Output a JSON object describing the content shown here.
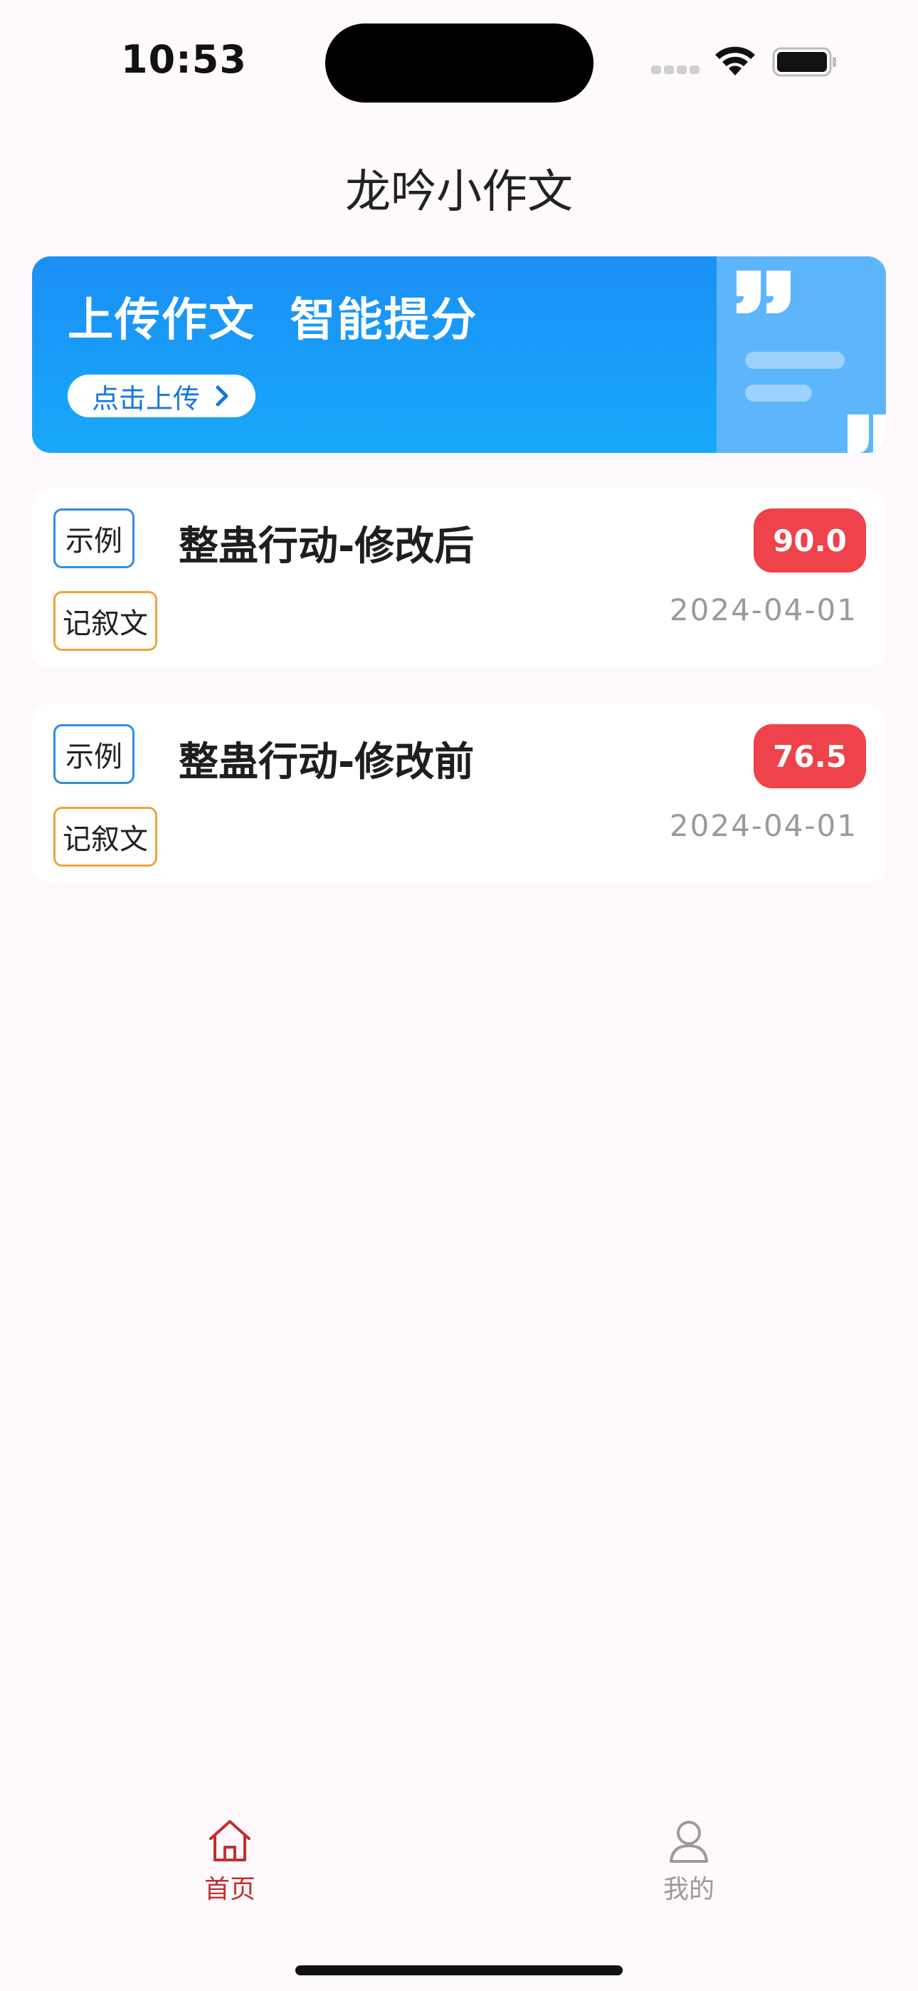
{
  "status_bar": {
    "time": "10:53"
  },
  "header": {
    "title": "龙吟小作文"
  },
  "banner": {
    "title": "上传作文  智能提分",
    "button_label": "点击上传",
    "colors": {
      "start": "#1a8ff5",
      "end": "#18a9fb",
      "deco": "#5db6fb"
    }
  },
  "essays": [
    {
      "tag": "示例",
      "genre": "记叙文",
      "title": "整蛊行动-修改后",
      "score": "90.0",
      "date": "2024-04-01"
    },
    {
      "tag": "示例",
      "genre": "记叙文",
      "title": "整蛊行动-修改前",
      "score": "76.5",
      "date": "2024-04-01"
    }
  ],
  "tabbar": {
    "items": [
      {
        "label": "首页",
        "icon": "home-icon",
        "active": true
      },
      {
        "label": "我的",
        "icon": "user-icon",
        "active": false
      }
    ],
    "active_color": "#c0302f",
    "inactive_color": "#9b9b9b"
  }
}
